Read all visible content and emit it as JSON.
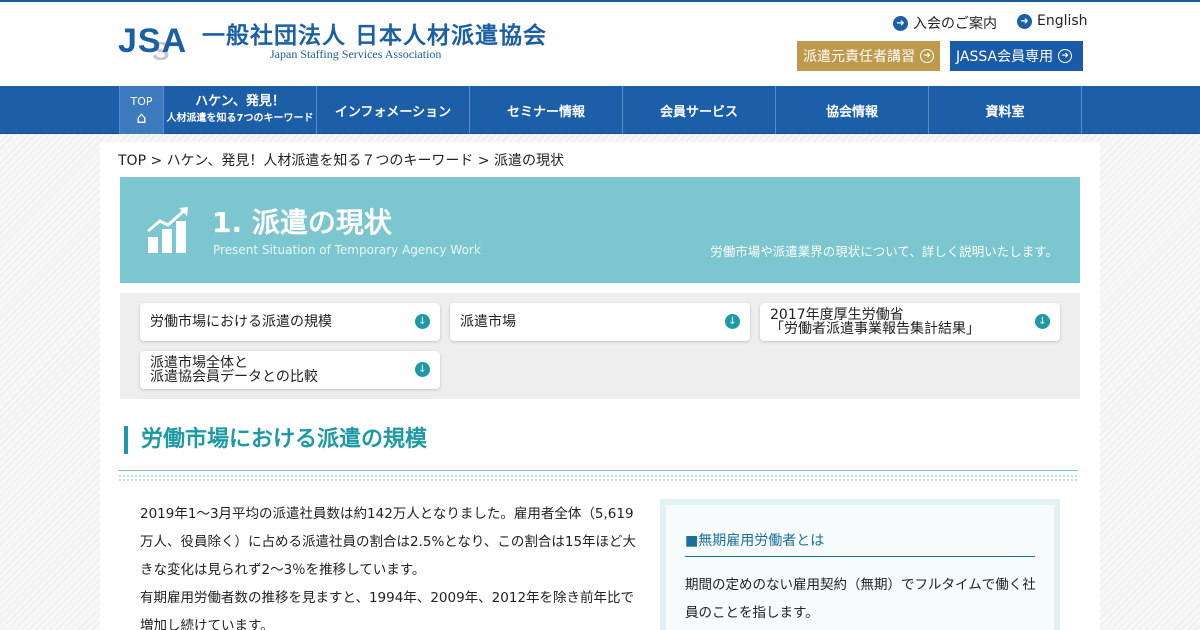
{
  "header": {
    "logo_jsa": "JSA",
    "logo_title": "一般社団法人 日本人材派遣協会",
    "logo_sub": "Japan Staffing Services Association",
    "links": [
      {
        "label": "入会のご案内"
      },
      {
        "label": "English"
      }
    ],
    "buttons": [
      {
        "label": "派遣元責任者講習",
        "color": "#bd9a4c"
      },
      {
        "label": "JASSA会員専用",
        "color": "#1a5aa8"
      }
    ]
  },
  "nav": {
    "top_label": "TOP",
    "items": [
      {
        "label": "ハケン、発見！",
        "sub": "人材派遣を知る7つのキーワード"
      },
      {
        "label": "インフォメーション"
      },
      {
        "label": "セミナー情報"
      },
      {
        "label": "会員サービス"
      },
      {
        "label": "協会情報"
      },
      {
        "label": "資料室"
      }
    ]
  },
  "breadcrumb": "TOP > ハケン、発見！人材派遣を知る７つのキーワード > 派遣の現状",
  "hero": {
    "title": "1. 派遣の現状",
    "subtitle_en": "Present Situation of Temporary Agency Work",
    "description": "労働市場や派遣業界の現状について、詳しく説明いたします。"
  },
  "anchors": [
    {
      "line1": "労働市場における派遣の規模",
      "line2": ""
    },
    {
      "line1": "派遣市場",
      "line2": ""
    },
    {
      "line1": "2017年度厚生労働省",
      "line2": "「労働者派遣事業報告集計結果」"
    },
    {
      "line1": "派遣市場全体と",
      "line2": "派遣協会員データとの比較"
    }
  ],
  "section": {
    "title": "労働市場における派遣の規模",
    "paragraphs": [
      "2019年1～3月平均の派遣社員数は約142万人となりました。雇用者全体（5,619万人、役員除く）に占める派遣社員の割合は2.5%となり、この割合は15年ほど大きな変化は見られず2～3％を推移しています。",
      "有期雇用労働者数の推移を見ますと、1994年、2009年、2012年を除き前年比で増加し続けています。"
    ]
  },
  "sidebox": {
    "title": "■無期雇用労働者とは",
    "text": "期間の定めのない雇用契約（無期）でフルタイムで働く社員のことを指します。"
  },
  "colors": {
    "brand_blue": "#1b5fa5",
    "teal": "#1e9aa6",
    "hero_bg": "#7cc6cf",
    "gold": "#bd9a4c"
  }
}
